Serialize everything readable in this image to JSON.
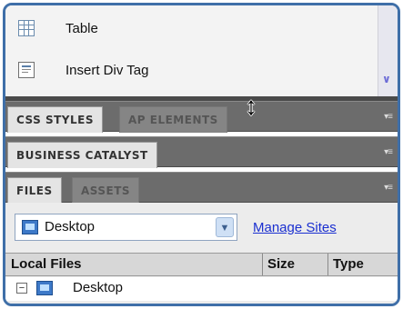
{
  "insert_panel": {
    "items": [
      {
        "label": "Table",
        "icon": "table-icon"
      },
      {
        "label": "Insert Div Tag",
        "icon": "div-tag-icon"
      }
    ]
  },
  "panel_groups": {
    "css": {
      "tabs": [
        {
          "label": "CSS STYLES",
          "active": true
        },
        {
          "label": "AP ELEMENTS",
          "active": false
        }
      ]
    },
    "business": {
      "tabs": [
        {
          "label": "BUSINESS CATALYST",
          "active": true
        }
      ]
    },
    "files": {
      "tabs": [
        {
          "label": "FILES",
          "active": true
        },
        {
          "label": "ASSETS",
          "active": false
        }
      ]
    }
  },
  "files_panel": {
    "site_select": {
      "value": "Desktop"
    },
    "manage_sites_label": "Manage Sites",
    "columns": [
      "Local Files",
      "Size",
      "Type"
    ],
    "tree": [
      {
        "label": "Desktop",
        "expanded": true,
        "toggle": "−"
      }
    ]
  },
  "colors": {
    "accent_frame": "#3f6fa8",
    "link": "#1a2fd0",
    "panel_bar": "#6c6c6c"
  }
}
